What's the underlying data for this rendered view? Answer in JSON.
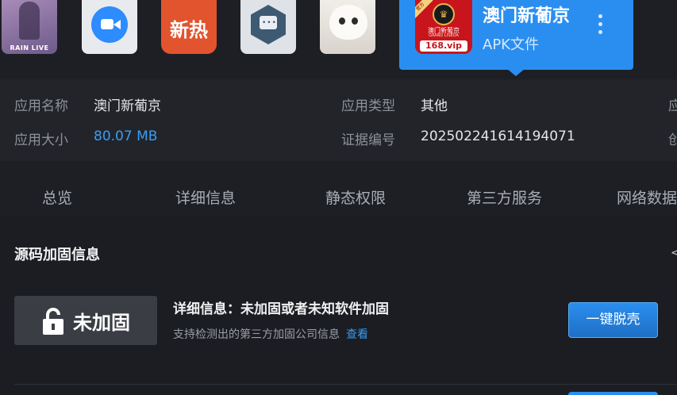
{
  "icons": {
    "rain_label": "RAIN LIVE",
    "hot_label": "新热",
    "chat_dots": "•••"
  },
  "selected_app": {
    "title": "澳门新葡京",
    "subtitle": "APK文件",
    "icon_url_text": "168.vip",
    "icon_name": "澳门新葡京",
    "icon_name_en": "GRAND LISBOA",
    "icon_badge": "官方"
  },
  "info": {
    "name_label": "应用名称",
    "name_value": "澳门新葡京",
    "type_label": "应用类型",
    "type_value": "其他",
    "size_label": "应用大小",
    "size_value": "80.07 MB",
    "evidence_label": "证据编号",
    "evidence_value": "2025022416141940 71",
    "right_edge_1": "应",
    "right_edge_2": "创"
  },
  "tabs": [
    "总览",
    "详细信息",
    "静态权限",
    "第三方服务",
    "网络数据"
  ],
  "section": {
    "title": "源码加固信息",
    "status": "未加固",
    "detail_title": "详细信息：未加固或者未知软件加固",
    "detail_sub": "支持检测出的第三方加固公司信息",
    "detail_link": "查看",
    "button": "一键脱壳",
    "edge_glyph": "<"
  },
  "colors": {
    "accent": "#2a8ef0",
    "link": "#3a9cf2",
    "background": "#1b1d22"
  }
}
